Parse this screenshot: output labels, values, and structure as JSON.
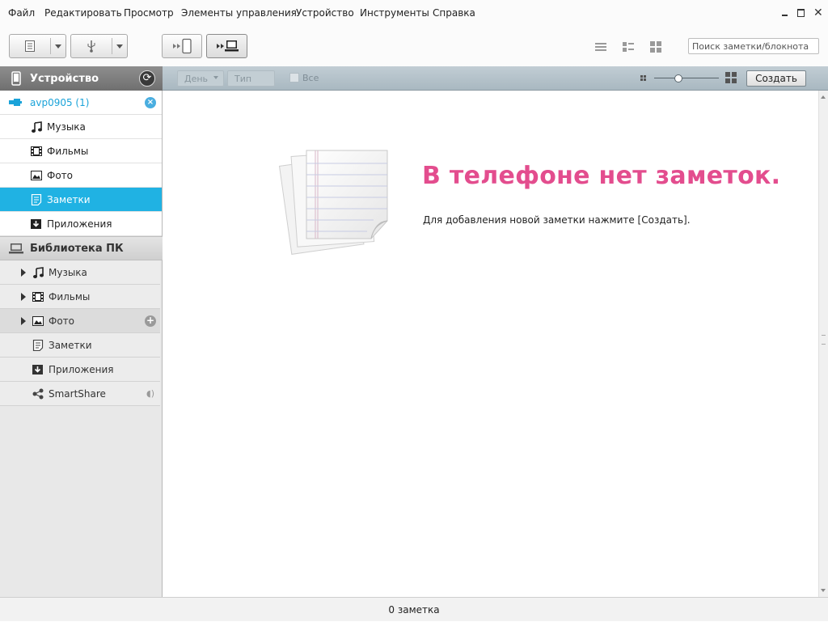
{
  "menu": {
    "items": [
      "Файл",
      "Редактировать",
      "Просмотр",
      "Элементы управления",
      "Устройство",
      "Инструменты",
      "Справка"
    ]
  },
  "toolbar": {
    "search_value": "Поиск заметки/блокнота"
  },
  "sidebar": {
    "device_header": "Устройство",
    "device_name": "avp0905 (1)",
    "device_items": [
      {
        "label": "Музыка",
        "icon": "music-note-icon"
      },
      {
        "label": "Фильмы",
        "icon": "film-icon"
      },
      {
        "label": "Фото",
        "icon": "photo-icon"
      },
      {
        "label": "Заметки",
        "icon": "note-icon",
        "active": true
      },
      {
        "label": "Приложения",
        "icon": "app-download-icon"
      }
    ],
    "library_header": "Библиотека ПК",
    "library_items": [
      {
        "label": "Музыка",
        "icon": "music-note-icon"
      },
      {
        "label": "Фильмы",
        "icon": "film-icon"
      },
      {
        "label": "Фото",
        "icon": "photo-icon"
      },
      {
        "label": "Заметки",
        "icon": "note-icon"
      },
      {
        "label": "Приложения",
        "icon": "app-download-icon"
      },
      {
        "label": "SmartShare",
        "icon": "smartshare-icon"
      }
    ]
  },
  "filterbar": {
    "day_label": "День",
    "type_label": "Тип",
    "all_label": "Все",
    "create_label": "Создать"
  },
  "main": {
    "empty_title": "В телефоне нет заметок.",
    "empty_hint": "Для добавления новой заметки нажмите [Создать]."
  },
  "status": {
    "text": "0 заметка"
  },
  "colors": {
    "accent": "#20b2e3",
    "empty_title": "#e34d8e",
    "device_link": "#1aa3d9"
  }
}
